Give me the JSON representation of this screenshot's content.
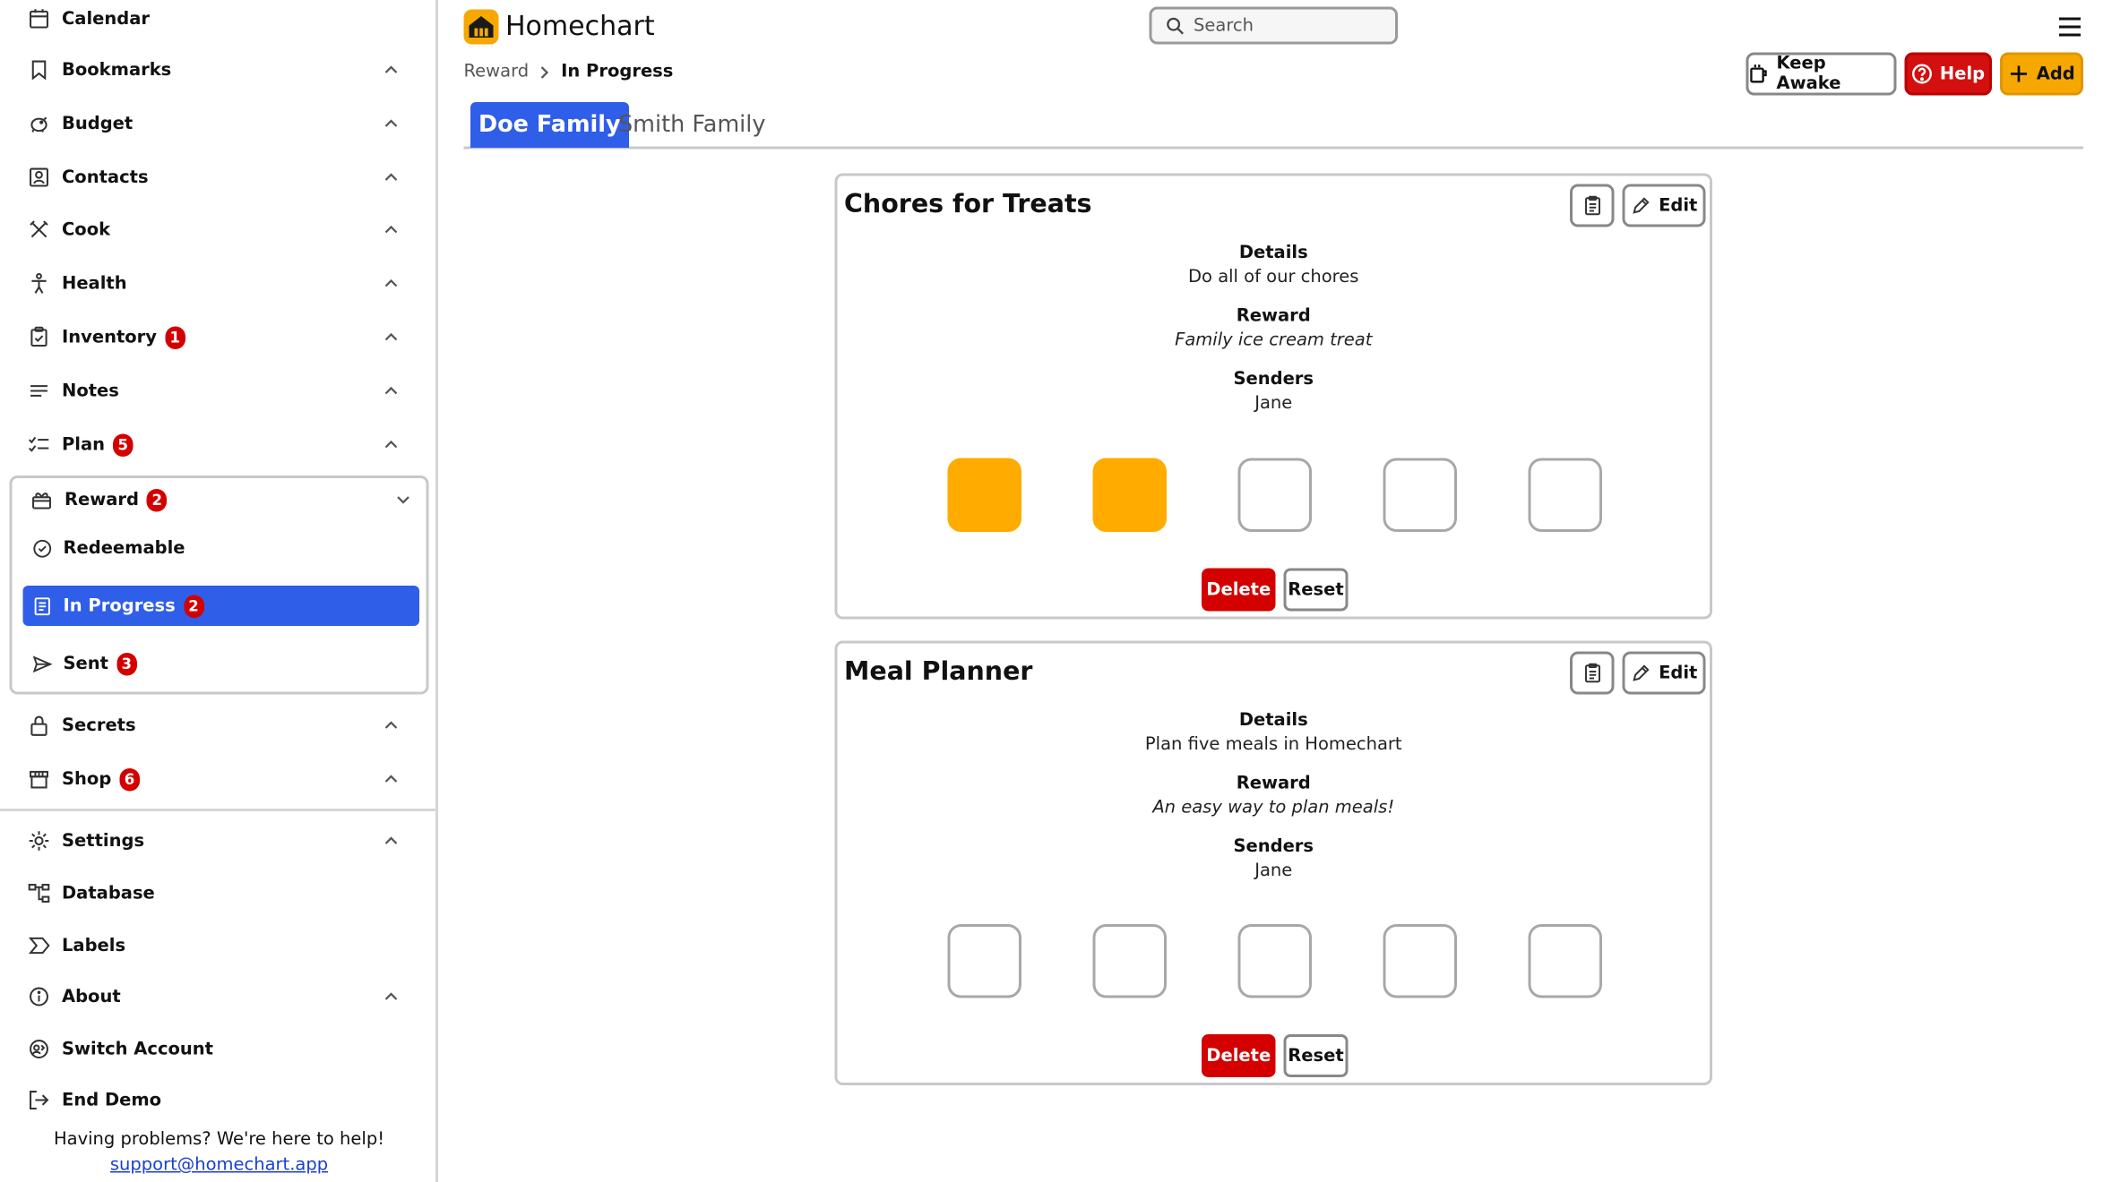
{
  "app": {
    "title": "Homechart"
  },
  "search": {
    "placeholder": "Search"
  },
  "breadcrumb": {
    "parent": "Reward",
    "current": "In Progress"
  },
  "header_buttons": {
    "keep_awake": "Keep Awake",
    "help": "Help",
    "add": "Add"
  },
  "tabs": [
    {
      "label": "Doe Family",
      "active": true
    },
    {
      "label": "Smith Family",
      "active": false
    }
  ],
  "sidebar": {
    "items": [
      {
        "label": "Calendar",
        "icon": "calendar-icon"
      },
      {
        "label": "Bookmarks",
        "icon": "bookmark-icon"
      },
      {
        "label": "Budget",
        "icon": "piggy-bank-icon"
      },
      {
        "label": "Contacts",
        "icon": "contacts-icon"
      },
      {
        "label": "Cook",
        "icon": "utensils-icon"
      },
      {
        "label": "Health",
        "icon": "person-icon"
      },
      {
        "label": "Inventory",
        "icon": "clipboard-check-icon",
        "badge": "1"
      },
      {
        "label": "Notes",
        "icon": "notes-icon"
      },
      {
        "label": "Plan",
        "icon": "checklist-icon",
        "badge": "5"
      },
      {
        "label": "Reward",
        "icon": "gift-icon",
        "badge": "2"
      },
      {
        "label": "Secrets",
        "icon": "lock-icon"
      },
      {
        "label": "Shop",
        "icon": "store-icon",
        "badge": "6"
      },
      {
        "label": "Settings",
        "icon": "gear-icon"
      },
      {
        "label": "Database",
        "icon": "database-tree-icon"
      },
      {
        "label": "Labels",
        "icon": "label-icon"
      },
      {
        "label": "About",
        "icon": "info-icon"
      },
      {
        "label": "Switch Account",
        "icon": "switch-account-icon"
      },
      {
        "label": "End Demo",
        "icon": "exit-icon"
      }
    ],
    "reward_sub": [
      {
        "label": "Redeemable",
        "icon": "check-circle-icon"
      },
      {
        "label": "In Progress",
        "icon": "clipboard-icon",
        "badge": "2",
        "active": true
      },
      {
        "label": "Sent",
        "icon": "send-icon",
        "badge": "3"
      }
    ],
    "help_text": "Having problems? We're here to help!",
    "help_email": "support@homechart.app"
  },
  "cards": [
    {
      "title": "Chores for Treats",
      "edit_label": "Edit",
      "details_label": "Details",
      "details": "Do all of our chores",
      "reward_label": "Reward",
      "reward": "Family ice cream treat",
      "senders_label": "Senders",
      "senders": "Jane",
      "stamps_total": 5,
      "stamps_filled": 2,
      "delete_label": "Delete",
      "reset_label": "Reset"
    },
    {
      "title": "Meal Planner",
      "edit_label": "Edit",
      "details_label": "Details",
      "details": "Plan five meals in Homechart",
      "reward_label": "Reward",
      "reward": "An easy way to plan meals!",
      "senders_label": "Senders",
      "senders": "Jane",
      "stamps_total": 5,
      "stamps_filled": 0,
      "delete_label": "Delete",
      "reset_label": "Reset"
    }
  ],
  "colors": {
    "accent": "#2f5ee8",
    "stamp_filled": "#ffab00",
    "danger": "#d40000",
    "add": "#f7a800"
  }
}
